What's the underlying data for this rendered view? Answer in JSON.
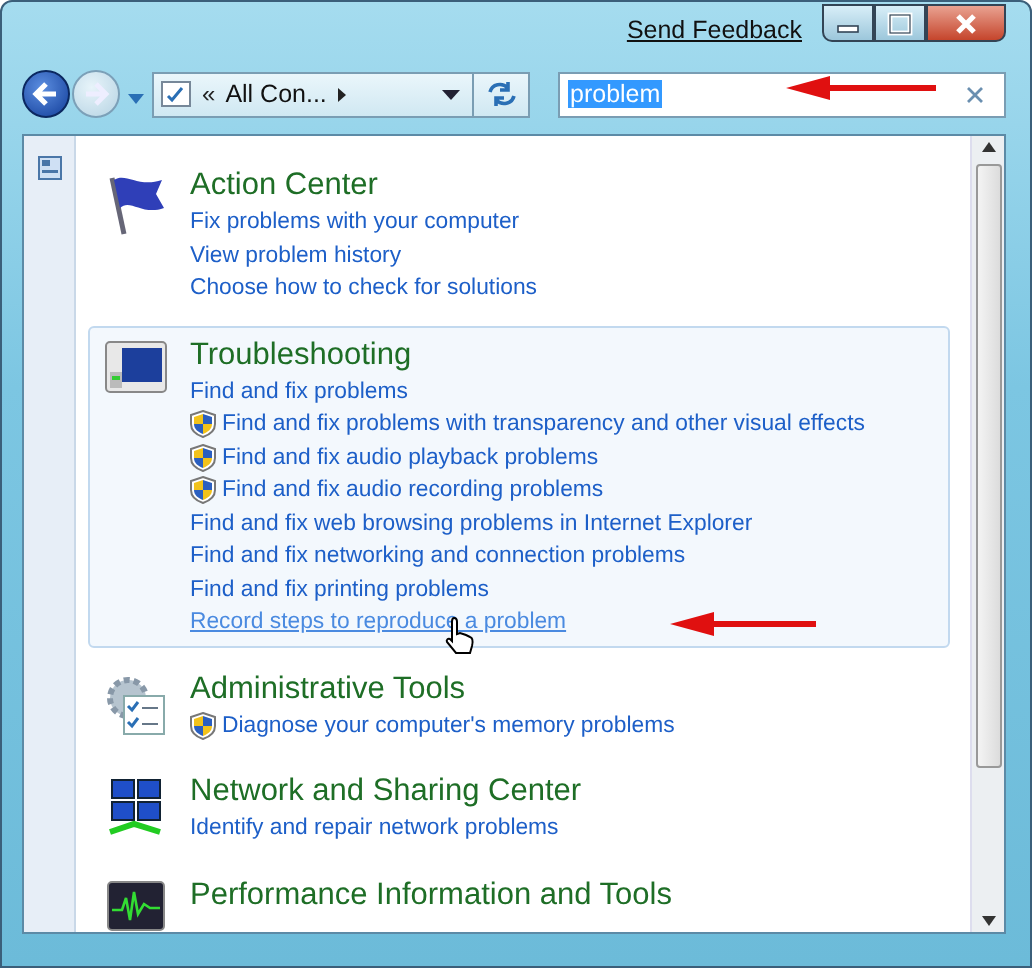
{
  "title_bar": {
    "feedback_link": "Send Feedback"
  },
  "address_bar": {
    "chevron": "«",
    "path": "All Con..."
  },
  "search": {
    "value": "problem",
    "text_selected": true
  },
  "results": [
    {
      "kind": "flag",
      "title": "Action Center",
      "highlighted": false,
      "links": [
        {
          "text": "Fix problems with your computer",
          "shield": false,
          "hovered": false
        },
        {
          "text": "View problem history",
          "shield": false,
          "hovered": false
        },
        {
          "text": "Choose how to check for solutions",
          "shield": false,
          "hovered": false
        }
      ]
    },
    {
      "kind": "troubleshooting",
      "title": "Troubleshooting",
      "highlighted": true,
      "links": [
        {
          "text": "Find and fix problems",
          "shield": false,
          "hovered": false
        },
        {
          "text": "Find and fix problems with transparency and other visual effects",
          "shield": true,
          "hovered": false
        },
        {
          "text": "Find and fix audio playback problems",
          "shield": true,
          "hovered": false
        },
        {
          "text": "Find and fix audio recording problems",
          "shield": true,
          "hovered": false
        },
        {
          "text": "Find and fix web browsing problems in Internet Explorer",
          "shield": false,
          "hovered": false
        },
        {
          "text": "Find and fix networking and connection problems",
          "shield": false,
          "hovered": false
        },
        {
          "text": "Find and fix printing problems",
          "shield": false,
          "hovered": false
        },
        {
          "text": "Record steps to reproduce a problem",
          "shield": false,
          "hovered": true
        }
      ]
    },
    {
      "kind": "admin",
      "title": "Administrative Tools",
      "highlighted": false,
      "links": [
        {
          "text": "Diagnose your computer's memory problems",
          "shield": true,
          "hovered": false
        }
      ]
    },
    {
      "kind": "network",
      "title": "Network and Sharing Center",
      "highlighted": false,
      "links": [
        {
          "text": "Identify and repair network problems",
          "shield": false,
          "hovered": false
        }
      ]
    },
    {
      "kind": "performance",
      "title": "Performance Information and Tools",
      "highlighted": false
    }
  ]
}
